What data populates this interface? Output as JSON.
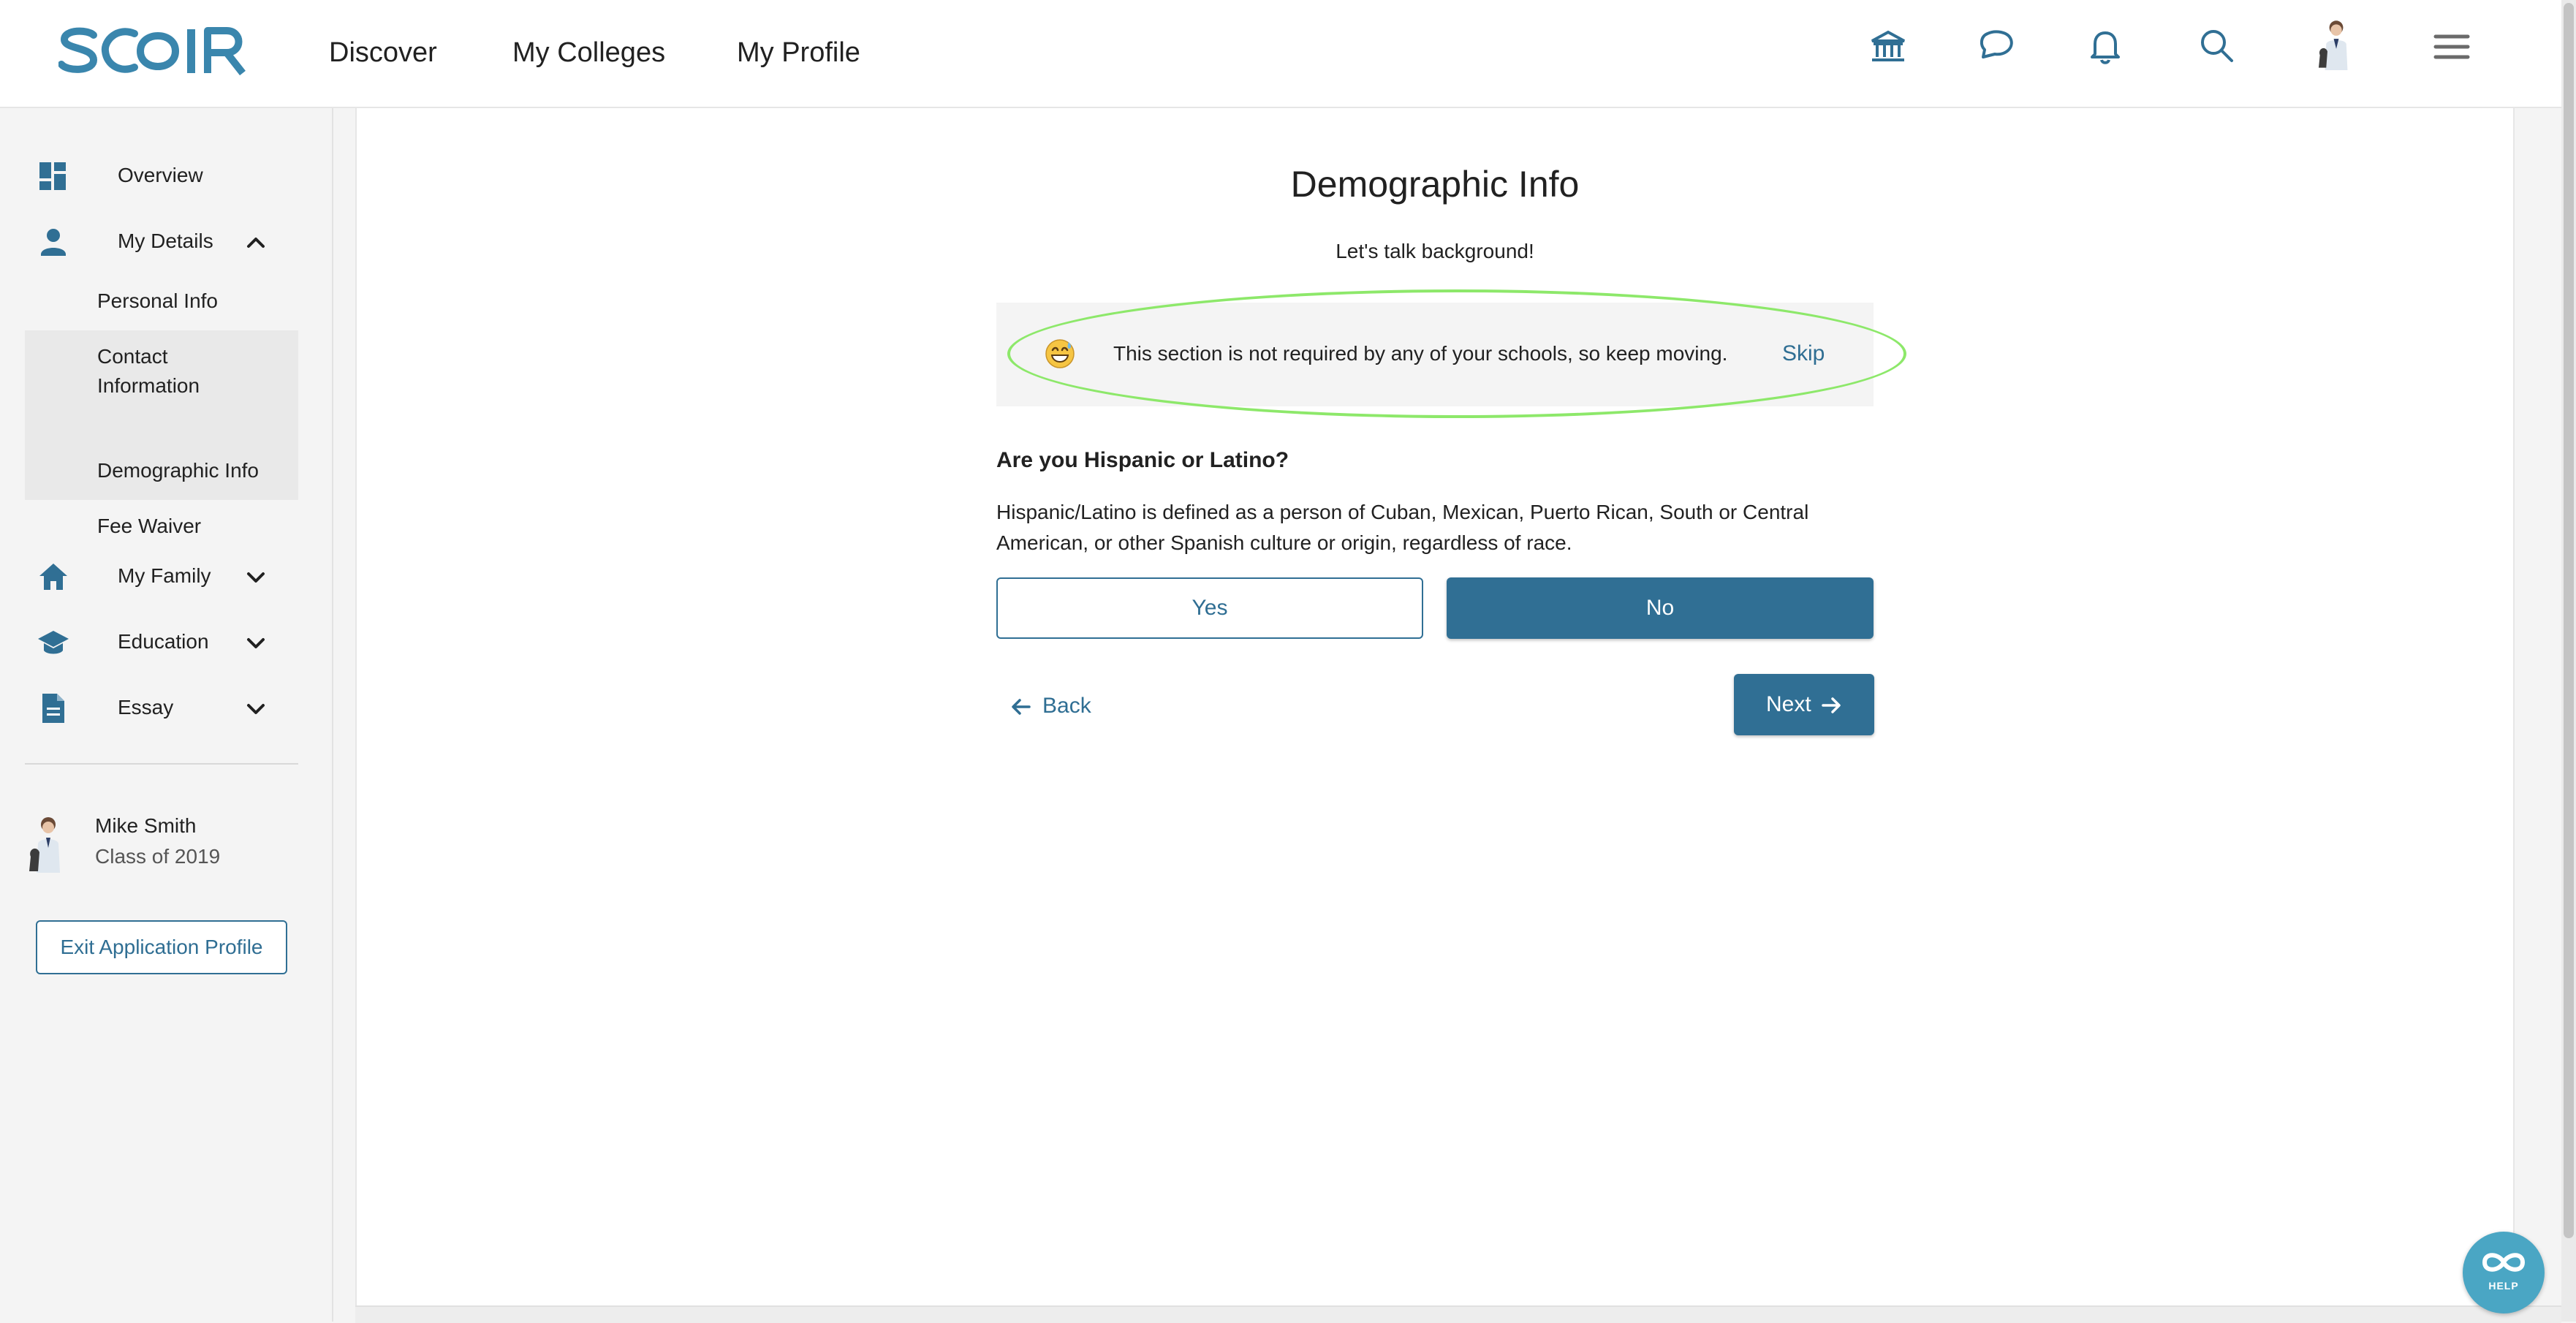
{
  "brand": {
    "logo_text": "SCOIR",
    "accent_color": "#306f94",
    "logo_color": "#3a86ad",
    "highlight_color": "#8de86a"
  },
  "topnav": {
    "links": [
      {
        "label": "Discover"
      },
      {
        "label": "My Colleges"
      },
      {
        "label": "My Profile"
      }
    ],
    "icons": [
      "institution-icon",
      "chat-icon",
      "bell-icon",
      "search-icon",
      "avatar",
      "hamburger-menu-icon"
    ]
  },
  "sidebar": {
    "items": [
      {
        "label": "Overview",
        "icon": "dashboard-icon"
      },
      {
        "label": "My Details",
        "icon": "person-icon",
        "expanded": true
      },
      {
        "label": "My Family",
        "icon": "home-icon",
        "expanded": false
      },
      {
        "label": "Education",
        "icon": "graduation-cap-icon",
        "expanded": false
      },
      {
        "label": "Essay",
        "icon": "document-icon",
        "expanded": false
      }
    ],
    "sub_items": [
      {
        "label": "Personal Info"
      },
      {
        "label": "Contact Information"
      },
      {
        "label": "Demographic Info"
      },
      {
        "label": "Fee Waiver"
      }
    ],
    "profile": {
      "name": "Mike Smith",
      "class_of": "Class of 2019"
    },
    "exit_button": "Exit Application Profile"
  },
  "main": {
    "title": "Demographic Info",
    "subtitle": "Let's talk background!",
    "notice": {
      "emoji": "grinning-sweat-emoji",
      "text": "This section is not required by any of your schools, so keep moving.",
      "skip_label": "Skip"
    },
    "question": "Are you Hispanic or Latino?",
    "definition": "Hispanic/Latino is defined as a person of Cuban, Mexican, Puerto Rican, South or Central American, or other Spanish culture or origin, regardless of race.",
    "options": [
      {
        "label": "Yes",
        "selected": false
      },
      {
        "label": "No",
        "selected": true
      }
    ],
    "back_label": "Back",
    "next_label": "Next"
  },
  "help": {
    "label": "HELP"
  }
}
